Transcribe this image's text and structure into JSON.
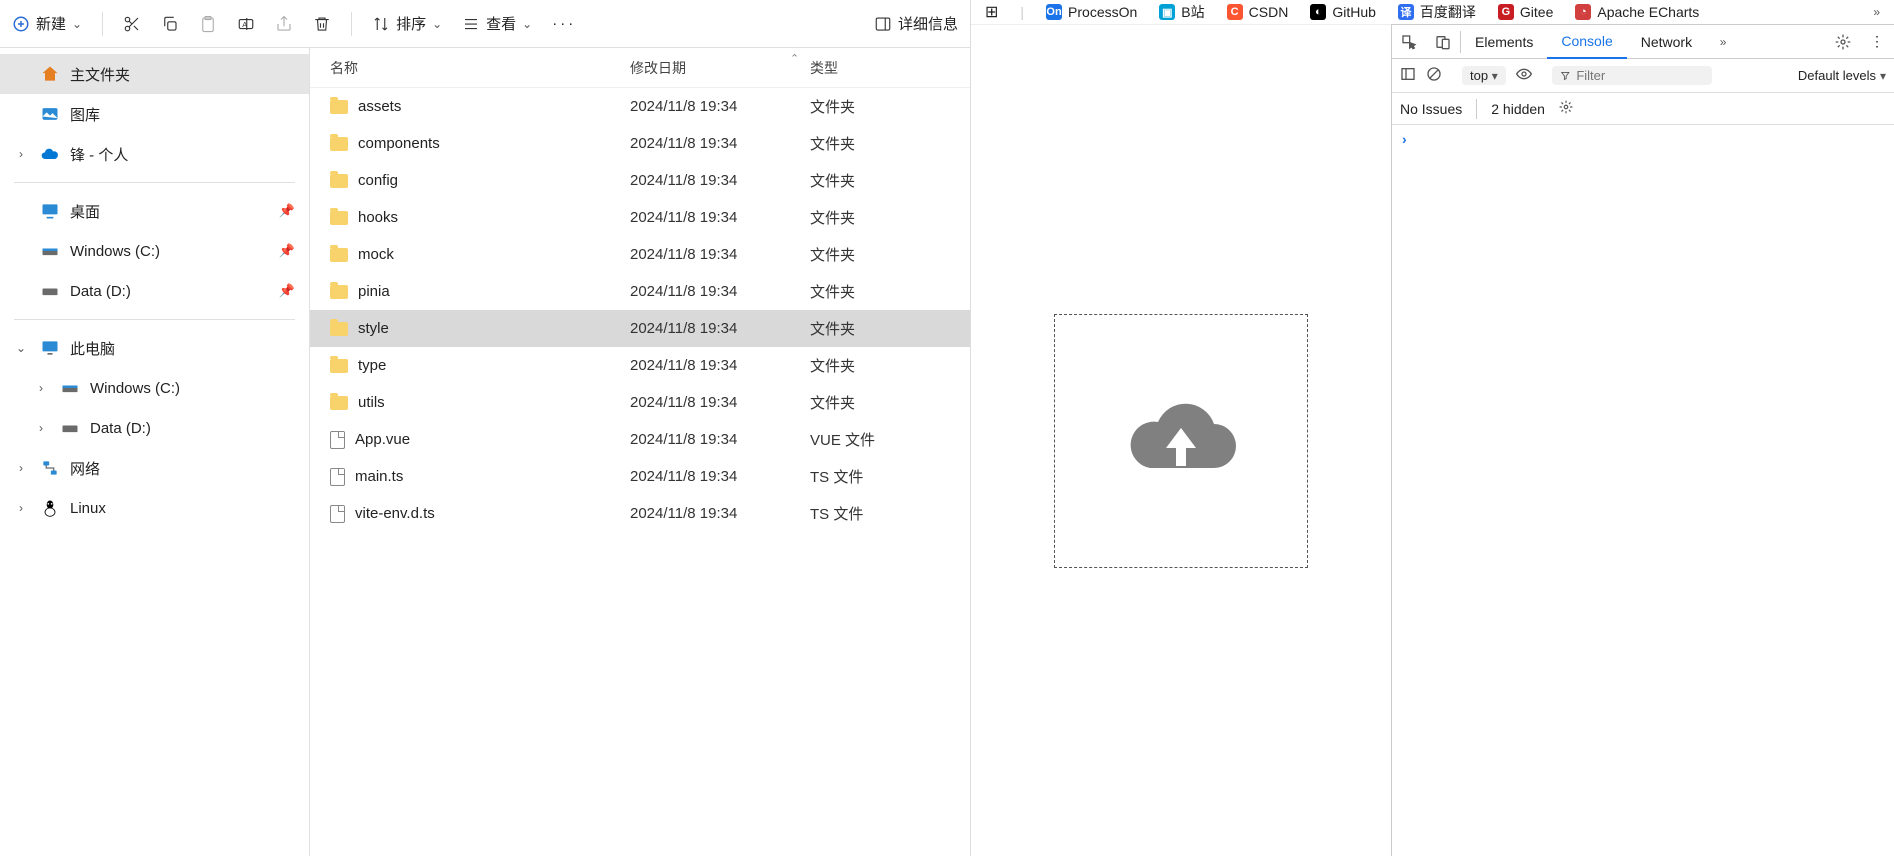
{
  "toolbar": {
    "new": "新建",
    "sort": "排序",
    "view": "查看",
    "details": "详细信息"
  },
  "sidebar": {
    "home": "主文件夹",
    "gallery": "图库",
    "onedrive": "锋 - 个人",
    "desktop": "桌面",
    "winc": "Windows (C:)",
    "datad": "Data (D:)",
    "thispc": "此电脑",
    "winc2": "Windows (C:)",
    "datad2": "Data (D:)",
    "network": "网络",
    "linux": "Linux"
  },
  "columns": {
    "name": "名称",
    "date": "修改日期",
    "type": "类型"
  },
  "types": {
    "folder": "文件夹",
    "vue": "VUE 文件",
    "ts": "TS 文件"
  },
  "files": [
    {
      "name": "assets",
      "date": "2024/11/8 19:34",
      "typeKey": "folder",
      "icon": "folder",
      "selected": false
    },
    {
      "name": "components",
      "date": "2024/11/8 19:34",
      "typeKey": "folder",
      "icon": "folder",
      "selected": false
    },
    {
      "name": "config",
      "date": "2024/11/8 19:34",
      "typeKey": "folder",
      "icon": "folder",
      "selected": false
    },
    {
      "name": "hooks",
      "date": "2024/11/8 19:34",
      "typeKey": "folder",
      "icon": "folder",
      "selected": false
    },
    {
      "name": "mock",
      "date": "2024/11/8 19:34",
      "typeKey": "folder",
      "icon": "folder",
      "selected": false
    },
    {
      "name": "pinia",
      "date": "2024/11/8 19:34",
      "typeKey": "folder",
      "icon": "folder",
      "selected": false
    },
    {
      "name": "style",
      "date": "2024/11/8 19:34",
      "typeKey": "folder",
      "icon": "folder",
      "selected": true
    },
    {
      "name": "type",
      "date": "2024/11/8 19:34",
      "typeKey": "folder",
      "icon": "folder",
      "selected": false
    },
    {
      "name": "utils",
      "date": "2024/11/8 19:34",
      "typeKey": "folder",
      "icon": "folder",
      "selected": false
    },
    {
      "name": "App.vue",
      "date": "2024/11/8 19:34",
      "typeKey": "vue",
      "icon": "file",
      "selected": false
    },
    {
      "name": "main.ts",
      "date": "2024/11/8 19:34",
      "typeKey": "ts",
      "icon": "file",
      "selected": false
    },
    {
      "name": "vite-env.d.ts",
      "date": "2024/11/8 19:34",
      "typeKey": "ts",
      "icon": "file",
      "selected": false
    }
  ],
  "bookmarks": [
    {
      "label": "ProcessOn",
      "color": "#1a73e8",
      "abbr": "On"
    },
    {
      "label": "B站",
      "color": "#00a1d6",
      "abbr": "▣"
    },
    {
      "label": "CSDN",
      "color": "#fc5531",
      "abbr": "C"
    },
    {
      "label": "GitHub",
      "color": "#000000",
      "abbr": "◐"
    },
    {
      "label": "百度翻译",
      "color": "#2f6ef0",
      "abbr": "译"
    },
    {
      "label": "Gitee",
      "color": "#c71d23",
      "abbr": "G"
    },
    {
      "label": "Apache ECharts",
      "color": "#d13f3f",
      "abbr": "◔"
    }
  ],
  "devtools": {
    "tabs": {
      "elements": "Elements",
      "console": "Console",
      "network": "Network"
    },
    "context": "top",
    "filter_placeholder": "Filter",
    "levels": "Default levels",
    "issues": "No Issues",
    "hidden": "2 hidden"
  }
}
